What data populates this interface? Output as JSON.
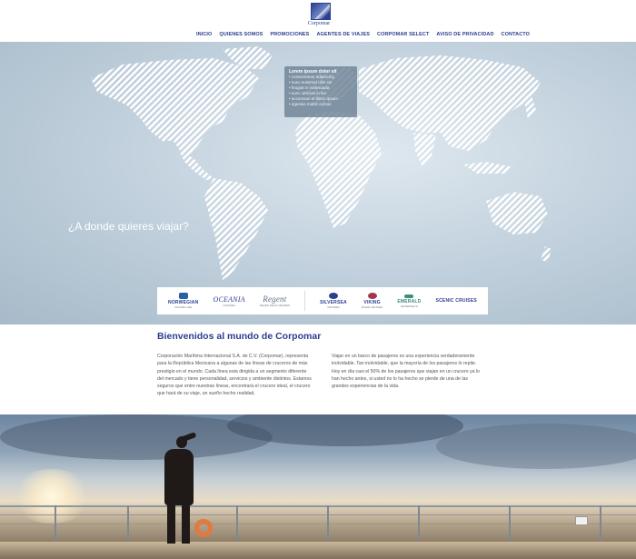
{
  "header": {
    "logo_text": "Corpomar",
    "nav": [
      "INICIO",
      "QUIENES SOMOS",
      "PROMOCIONES",
      "AGENTES DE VIAJES",
      "CORPOMAR SELECT",
      "AVISO DE PRIVACIDAD",
      "CONTACTO"
    ]
  },
  "hero": {
    "question": "¿A donde quieres viajar?",
    "tooltip": {
      "title": "Lorem ipsum dolor sit",
      "items": [
        "• consectetuer adipiscing",
        "• nunc euismod ullm sin",
        "• feugiat in malesuada",
        "• nunc ultricies in leo",
        "• accumsan et libero ipsum",
        "• egestas mattis cursus"
      ]
    },
    "brands": [
      {
        "name": "NORWEGIAN",
        "sub": "CRUISE LINE"
      },
      {
        "name": "OCEANIA",
        "sub": "CRUISES"
      },
      {
        "name": "Regent",
        "sub": "SEVEN SEAS CRUISES"
      },
      {
        "name": "SILVERSEA",
        "sub": "CRUISES"
      },
      {
        "name": "VIKING",
        "sub": "RIVER CRUISES"
      },
      {
        "name": "EMERALD",
        "sub": "WATERWAYS"
      },
      {
        "name": "SCENIC CRUISES",
        "sub": ""
      }
    ]
  },
  "welcome": {
    "title": "Bienvenidos al mundo de Corpomar",
    "col1": "Corporación Marítima Internacional S.A. de C.V. (Corpomar), representa para la República Mexicana a algunas de las líneas de cruceros de más prestigio en el mundo. Cada línea esta dirigida a un segmento diferente del mercado y tiene personalidad, servicios y ambiente distintos. Estamos seguros que entre nuestras líneas, encontrará el crucero ideal, el crucero que hará de su viaje, un sueño hecho realidad.",
    "col2": "Viajar en un barco de pasajeros es una experiencia verdaderamente inolvidable. Tan inolvidable, que la mayoría de los pasajeros lo repite. Hoy en día casi el 50% de los pasajeros que viajan en un crucero ya lo han hecho antes, si usted no lo ha hecho se pierde de una de las grandes experiencias de la vida."
  }
}
